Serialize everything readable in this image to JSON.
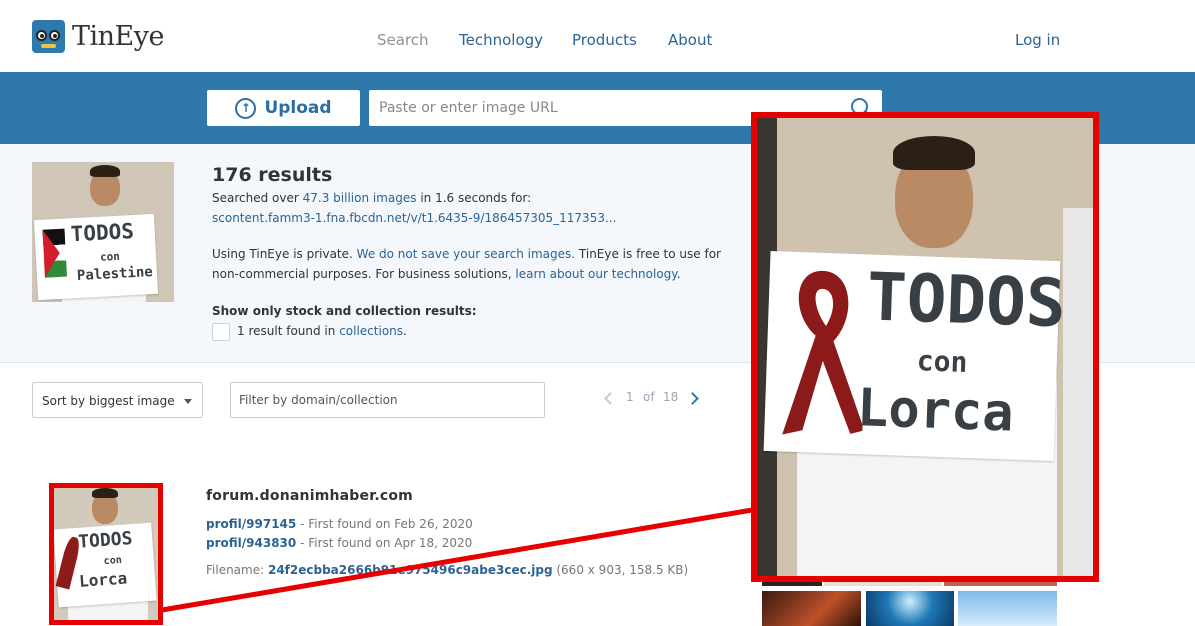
{
  "header": {
    "logo_text": "TinEye",
    "nav": [
      "Search",
      "Technology",
      "Products",
      "About"
    ],
    "login": "Log in"
  },
  "search": {
    "upload_label": "Upload",
    "url_placeholder": "Paste or enter image URL"
  },
  "summary": {
    "count": "176 results",
    "searched_prefix": "Searched over ",
    "searched_link": "47.3 billion images",
    "searched_suffix": " in 1.6 seconds for:",
    "query_url": "scontent.famm3-1.fna.fbcdn.net/v/t1.6435-9/186457305_117353...",
    "privacy_1": "Using TinEye is private. ",
    "privacy_link": "We do not save your search images.",
    "privacy_2": " TinEye is free to use for",
    "privacy_3": "non-commercial purposes. For business solutions, ",
    "privacy_link2": "learn about our technology",
    "privacy_end": ".",
    "stock_heading": "Show only stock and collection results:",
    "stock_prefix": "1 result found in ",
    "stock_link": "collections",
    "stock_end": ".",
    "query_sign": {
      "line1": "TODOS",
      "line2": "con",
      "line3": "Palestine"
    }
  },
  "controls": {
    "sort_label": "Sort by biggest image",
    "filter_placeholder": "Filter by domain/collection",
    "page_current": "1",
    "page_of": "of",
    "page_total": "18"
  },
  "result": {
    "domain": "forum.donanimhaber.com",
    "matches": [
      {
        "link": "profil/997145",
        "found": " - First found on Feb 26, 2020"
      },
      {
        "link": "profil/943830",
        "found": " - First found on Apr 18, 2020"
      }
    ],
    "filename_label": "Filename: ",
    "filename_link": "24f2ecbba2666b91e975496c9abe3cec.jpg",
    "filename_meta": " (660 x 903, 158.5 KB)",
    "sign": {
      "line1": "TODOS",
      "line2": "con",
      "line3": "Lorca"
    }
  },
  "colors": {
    "brand_blue": "#2f78aa",
    "link": "#2b6395",
    "highlight_red": "#e60000"
  }
}
